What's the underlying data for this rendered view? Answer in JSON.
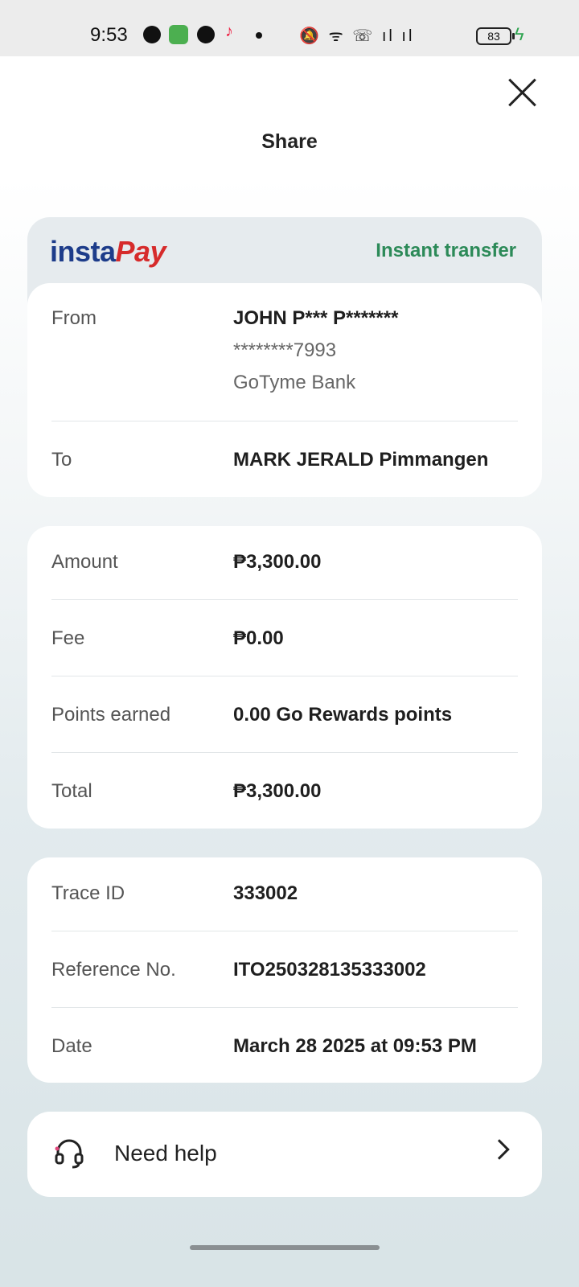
{
  "status_bar": {
    "time": "9:53",
    "battery": "83",
    "right_icons": "🔕 ᯤ ☏ ıl ıl"
  },
  "header": {
    "title": "Share"
  },
  "brand": {
    "logo_part1": "insta",
    "logo_part2": "Pay",
    "tag": "Instant transfer",
    "tag_color": "#2c8a58"
  },
  "parties": {
    "from_label": "From",
    "from_name": "JOHN P*** P*******",
    "from_account": "********7993",
    "from_bank": "GoTyme Bank",
    "to_label": "To",
    "to_name": "MARK JERALD Pimmangen"
  },
  "amounts": {
    "amount_label": "Amount",
    "amount_value": "₱3,300.00",
    "fee_label": "Fee",
    "fee_value": "₱0.00",
    "points_label": "Points earned",
    "points_value": "0.00 Go Rewards points",
    "total_label": "Total",
    "total_value": "₱3,300.00"
  },
  "details": {
    "trace_label": "Trace ID",
    "trace_value": "333002",
    "ref_label": "Reference No.",
    "ref_value": "ITO250328135333002",
    "date_label": "Date",
    "date_value": "March 28 2025 at 09:53 PM"
  },
  "help": {
    "label": "Need help"
  }
}
